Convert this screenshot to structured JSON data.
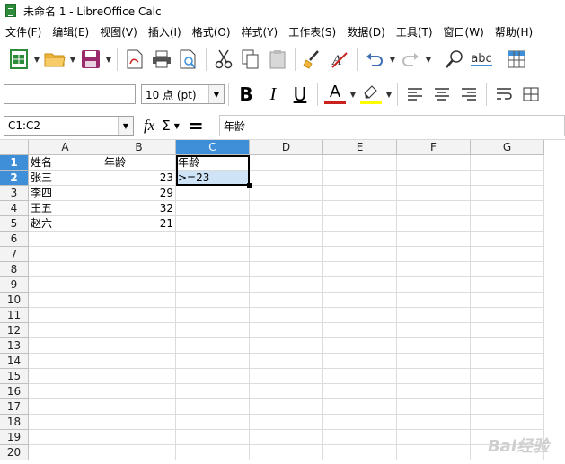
{
  "window": {
    "title": "未命名 1 - LibreOffice Calc"
  },
  "menu": [
    "文件(F)",
    "编辑(E)",
    "视图(V)",
    "插入(I)",
    "格式(O)",
    "样式(Y)",
    "工作表(S)",
    "数据(D)",
    "工具(T)",
    "窗口(W)",
    "帮助(H)"
  ],
  "toolbar": {
    "font_name": "",
    "font_size": "10 点 (pt)",
    "bold_label": "B",
    "italic_label": "I",
    "underline_label": "U",
    "font_color_label": "A",
    "font_color": "#c9211e",
    "highlight_color": "#ffff00",
    "spell_label": "abc"
  },
  "formula_bar": {
    "name_box": "C1:C2",
    "fx_label": "fx",
    "sum_label": "Σ",
    "equals_label": "=",
    "content": "年龄"
  },
  "sheet": {
    "columns": [
      "A",
      "B",
      "C",
      "D",
      "E",
      "F",
      "G"
    ],
    "rows": [
      "1",
      "2",
      "3",
      "4",
      "5",
      "6",
      "7",
      "8",
      "9",
      "10",
      "11",
      "12",
      "13",
      "14",
      "15",
      "16",
      "17",
      "18",
      "19",
      "20"
    ],
    "selected_column": "C",
    "selected_rows": [
      "1",
      "2"
    ],
    "cells": {
      "A1": "姓名",
      "B1": "年龄",
      "C1": "年龄",
      "A2": "张三",
      "B2": "23",
      "C2": ">=23",
      "A3": "李四",
      "B3": "29",
      "A4": "王五",
      "B4": "32",
      "A5": "赵六",
      "B5": "21"
    }
  },
  "watermark": "Bai经验"
}
